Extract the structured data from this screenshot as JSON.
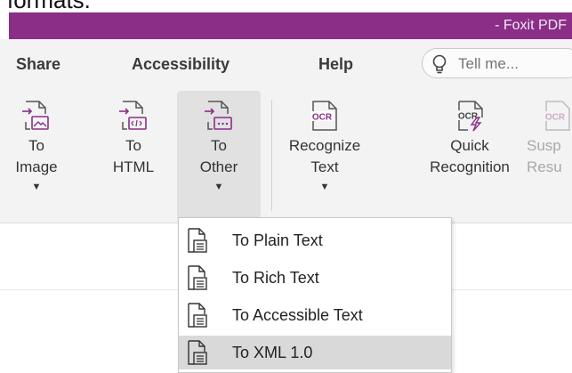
{
  "caption": "formats.",
  "window": {
    "title": "- Foxit PDF"
  },
  "menu": {
    "tabs": [
      {
        "label": "Share"
      },
      {
        "label": "Accessibility"
      },
      {
        "label": "Help"
      }
    ],
    "tell_me_placeholder": "Tell me..."
  },
  "toolbar": {
    "to_image": {
      "line1": "To",
      "line2": "Image"
    },
    "to_html": {
      "line1": "To",
      "line2": "HTML"
    },
    "to_other": {
      "line1": "To",
      "line2": "Other"
    },
    "recognize_text": {
      "line1": "Recognize",
      "line2": "Text"
    },
    "quick_recognition": {
      "line1": "Quick",
      "line2": "Recognition"
    },
    "suspects": {
      "line1": "Susp",
      "line2": "Resu"
    },
    "caret": "▼",
    "ocr_label": "OCR"
  },
  "dropdown": {
    "items": [
      {
        "label": "To Plain Text"
      },
      {
        "label": "To Rich Text"
      },
      {
        "label": "To Accessible Text"
      },
      {
        "label": "To XML 1.0"
      }
    ]
  },
  "colors": {
    "title_bar": "#8a2e87",
    "icon_purple": "#8a2e87",
    "hover": "#d9d9d9"
  }
}
